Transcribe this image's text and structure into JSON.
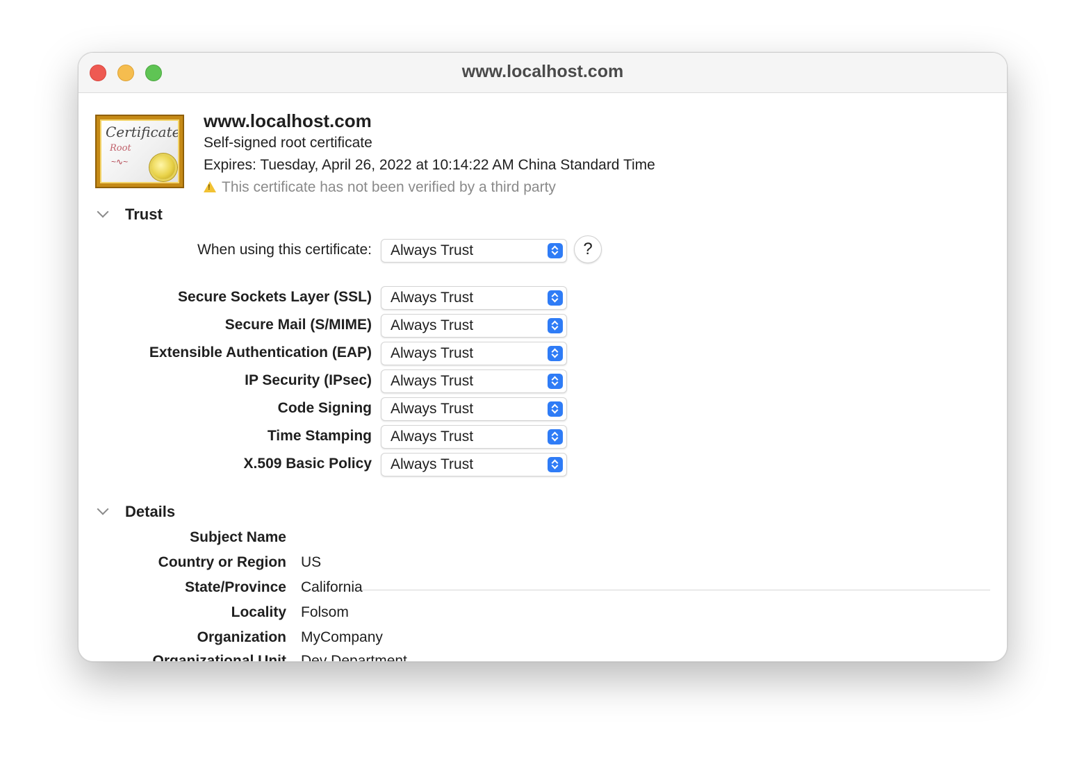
{
  "window": {
    "title": "www.localhost.com"
  },
  "header": {
    "name": "www.localhost.com",
    "subtitle": "Self-signed root certificate",
    "expires": "Expires: Tuesday, April 26, 2022 at 10:14:22 AM China Standard Time",
    "warning": "This certificate has not been verified by a third party"
  },
  "trust": {
    "section_label": "Trust",
    "when_using_label": "When using this certificate:",
    "when_using_value": "Always Trust",
    "help_label": "?",
    "policies": [
      {
        "label": "Secure Sockets Layer (SSL)",
        "value": "Always Trust"
      },
      {
        "label": "Secure Mail (S/MIME)",
        "value": "Always Trust"
      },
      {
        "label": "Extensible Authentication (EAP)",
        "value": "Always Trust"
      },
      {
        "label": "IP Security (IPsec)",
        "value": "Always Trust"
      },
      {
        "label": "Code Signing",
        "value": "Always Trust"
      },
      {
        "label": "Time Stamping",
        "value": "Always Trust"
      },
      {
        "label": "X.509 Basic Policy",
        "value": "Always Trust"
      }
    ]
  },
  "details": {
    "section_label": "Details",
    "subject_name_label": "Subject Name",
    "rows": [
      {
        "label": "Country or Region",
        "value": "US"
      },
      {
        "label": "State/Province",
        "value": "California"
      },
      {
        "label": "Locality",
        "value": "Folsom"
      },
      {
        "label": "Organization",
        "value": "MyCompany"
      },
      {
        "label": "Organizational Unit",
        "value": "Dev Department"
      }
    ]
  },
  "colors": {
    "accent": "#2f7cf6",
    "close": "#ee5a52",
    "minimize": "#f5bd4f",
    "maximize": "#5fc454",
    "warning": "#f2c233"
  },
  "icons": {
    "certificate": "certificate-icon",
    "warning": "warning-triangle-icon",
    "stepper": "up-down-chevron-icon",
    "disclosure": "chevron-down-icon"
  }
}
